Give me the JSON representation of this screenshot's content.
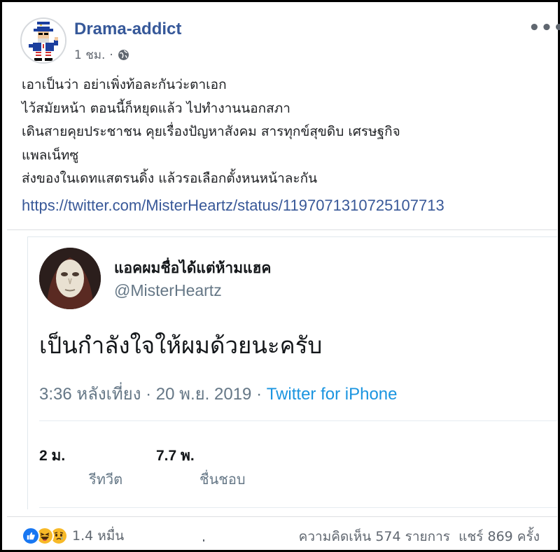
{
  "post": {
    "page_name": "Drama-addict",
    "time": "1 ชม.",
    "text_lines": [
      "เอาเป็นว่า อย่าเพิ่งท้อละกันว่ะตาเอก",
      "ไว้สมัยหน้า ตอนนี้ก็หยุดแล้ว ไปทำงานนอกสภา",
      "เดินสายคุยประชาชน คุยเรื่องปัญหาสังคม สารทุกข์สุขดิบ เศรษฐกิจ",
      "แพลเน็ทซู",
      "ส่งของในเดทแสตรนดิ้ง แล้วรอเลือกตั้งหนหน้าละกัน"
    ],
    "link": "https://twitter.com/MisterHeartz/status/1197071310725107713"
  },
  "tweet": {
    "name": "แอคผมชื่อได้แต่ห้ามแฮค",
    "handle": "@MisterHeartz",
    "text": "เป็นกำลังใจให้ผมด้วยนะครับ",
    "timestamp": "3:36 หลังเที่ยง · 20 พ.ย. 2019 · ",
    "source": "Twitter for iPhone",
    "retweets_count": "2 ม.",
    "retweets_label": "รีทวีต",
    "likes_count": "7.7 พ.",
    "likes_label": "ชื่นชอบ"
  },
  "footer": {
    "reaction_count": "1.4 หมื่น",
    "comments": "ความคิดเห็น 574 รายการ",
    "shares": "แชร์ 869 ครั้ง"
  },
  "icons": [
    "avatar",
    "globe-icon",
    "more-options-icon",
    "like-icon",
    "haha-icon",
    "sad-icon"
  ],
  "colors": {
    "link": "#385898",
    "page_name": "#365899",
    "twitter_blue": "#1b95e0",
    "like": "#1877f2",
    "reaction_yellow": "#f7b928"
  }
}
